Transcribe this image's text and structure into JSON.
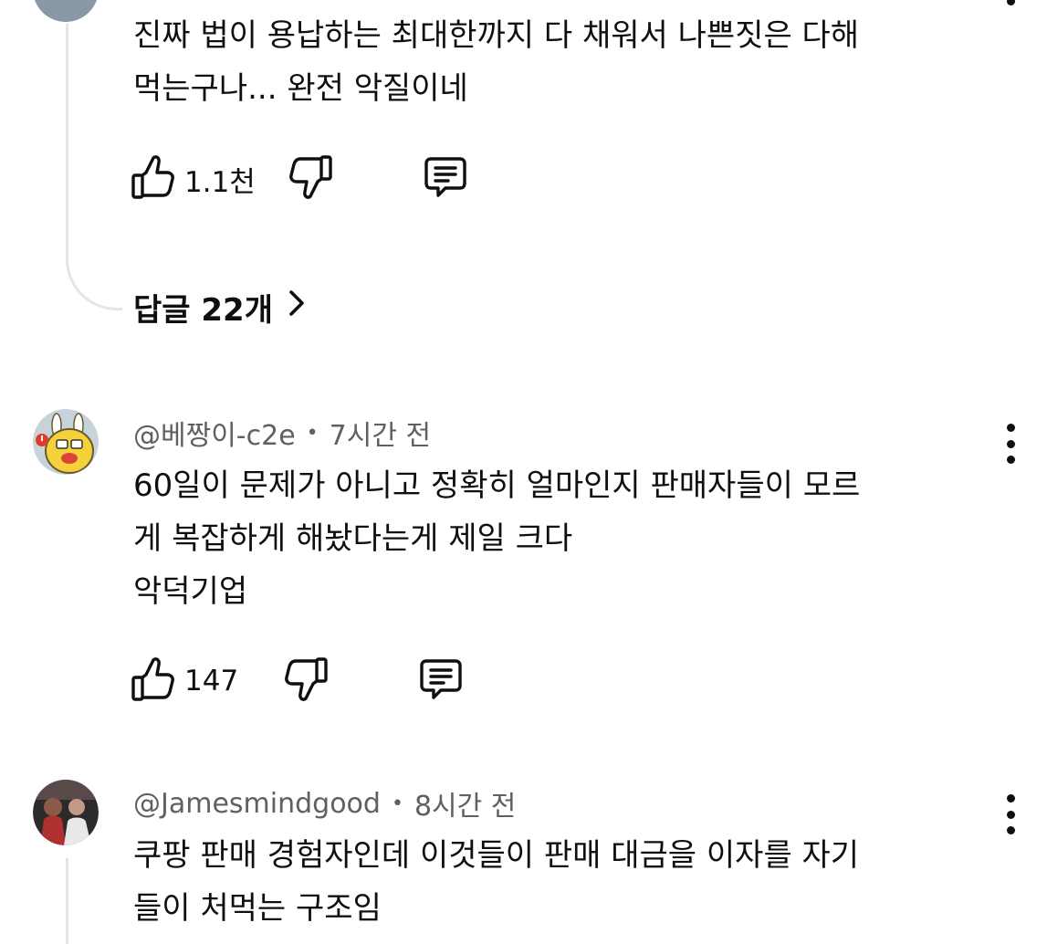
{
  "comments": [
    {
      "lines": [
        "진짜 법이 용납하는 최대한까지 다 채워서 나쁜짓은 다해",
        "먹는구나... 완전 악질이네"
      ],
      "like_count": "1.1천",
      "replies_label": "답글 22개"
    },
    {
      "author": "@베짱이-c2e",
      "time": "7시간 전",
      "lines": [
        "60일이 문제가 아니고 정확히 얼마인지 판매자들이 모르",
        "게 복잡하게 해놨다는게 제일 크다",
        "악덕기업"
      ],
      "like_count": "147"
    },
    {
      "author": "@Jamesmindgood",
      "time": "8시간 전",
      "lines": [
        "쿠팡 판매 경험자인데 이것들이 판매 대금을 이자를 자기",
        "들이 처먹는 구조임"
      ]
    }
  ],
  "separator": "•",
  "icons": {
    "like": "thumbs-up-icon",
    "dislike": "thumbs-down-icon",
    "reply": "comment-icon",
    "more": "more-vertical-icon",
    "chevron": "chevron-right-icon"
  }
}
